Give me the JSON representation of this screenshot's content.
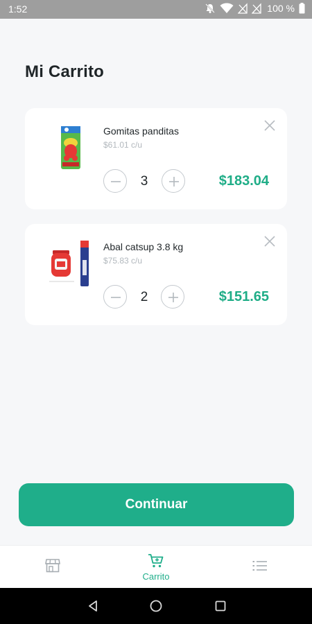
{
  "status_bar": {
    "time": "1:52",
    "battery": "100 %",
    "icons": [
      "notifications-off-icon",
      "wifi-icon",
      "no-signal-icon",
      "no-signal-icon",
      "battery-icon"
    ]
  },
  "header": {
    "title": "Mi Carrito"
  },
  "cart": {
    "items": [
      {
        "name": "Gomitas panditas",
        "unit_price": "$61.01 c/u",
        "quantity": "3",
        "total": "$183.04",
        "image": "gummy-candy-bag"
      },
      {
        "name": "Abal catsup 3.8 kg",
        "unit_price": "$75.83 c/u",
        "quantity": "2",
        "total": "$151.65",
        "image": "ketchup-jar-and-pack"
      }
    ]
  },
  "actions": {
    "continue_label": "Continuar"
  },
  "bottom_nav": {
    "items": [
      {
        "icon": "store-icon",
        "label": ""
      },
      {
        "icon": "cart-icon",
        "label": "Carrito",
        "active": true
      },
      {
        "icon": "list-icon",
        "label": ""
      }
    ]
  },
  "colors": {
    "accent": "#1fae8a",
    "price": "#1fad87",
    "background": "#f6f7f9",
    "status_bar": "#9e9e9e"
  }
}
